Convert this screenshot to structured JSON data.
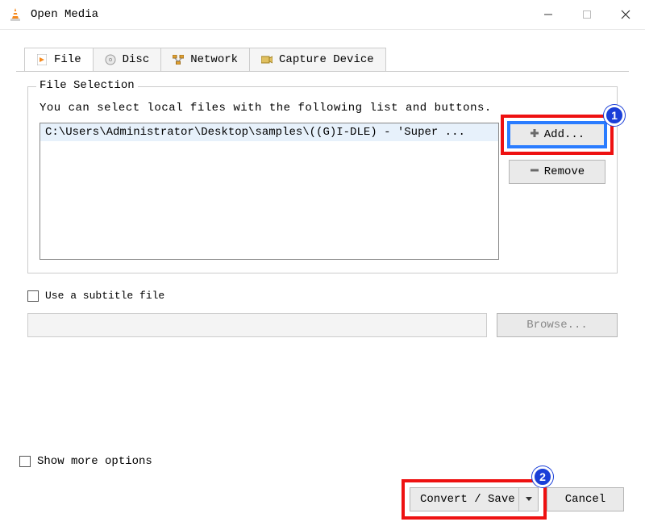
{
  "window": {
    "title": "Open Media"
  },
  "tabs": {
    "file": "File",
    "disc": "Disc",
    "network": "Network",
    "capture": "Capture Device"
  },
  "fileSelection": {
    "groupTitle": "File Selection",
    "help": "You can select local files with the following list and buttons.",
    "files": [
      "C:\\Users\\Administrator\\Desktop\\samples\\((G)I-DLE) - 'Super ..."
    ],
    "add": "Add...",
    "remove": "Remove"
  },
  "subtitle": {
    "label": "Use a subtitle file",
    "browse": "Browse..."
  },
  "footer": {
    "showMore": "Show more options",
    "convert": "Convert / Save",
    "cancel": "Cancel"
  },
  "annotations": {
    "one": "1",
    "two": "2"
  }
}
